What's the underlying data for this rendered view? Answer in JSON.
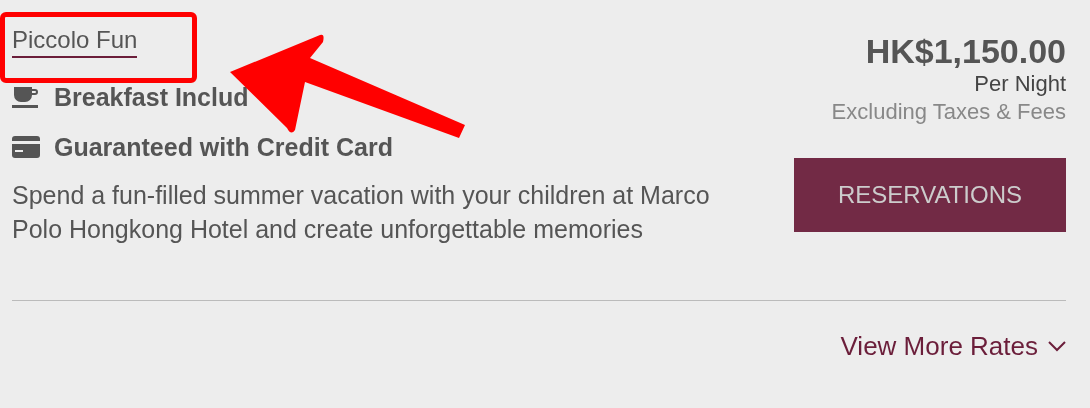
{
  "rate": {
    "title": "Piccolo Fun",
    "features": [
      {
        "kind": "breakfast",
        "label": "Breakfast Includ"
      },
      {
        "kind": "card",
        "label": "Guaranteed with Credit Card"
      }
    ],
    "description": "Spend a fun-filled summer vacation with your children at Marco Polo Hongkong Hotel and create unforgettable memories",
    "price": "HK$1,150.00",
    "per": "Per Night",
    "note": "Excluding Taxes & Fees",
    "button": "RESERVATIONS"
  },
  "more_link": "View More Rates"
}
